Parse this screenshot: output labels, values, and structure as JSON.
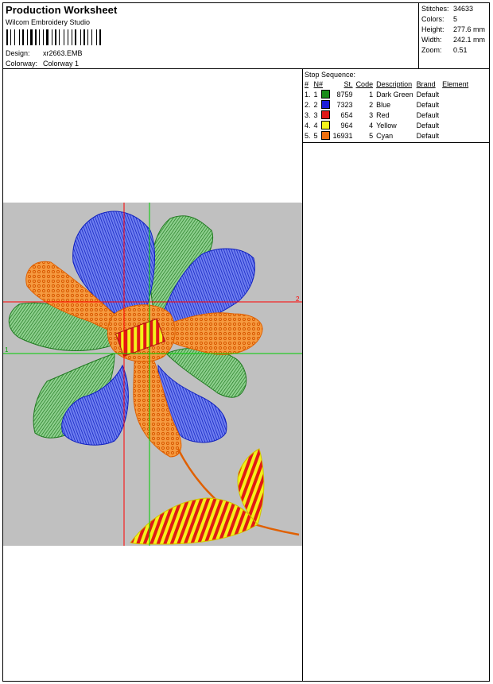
{
  "header": {
    "title": "Production Worksheet",
    "software": "Wilcom Embroidery Studio",
    "design_label": "Design:",
    "design_value": "xr2663.EMB",
    "colorway_label": "Colorway:",
    "colorway_value": "Colorway 1"
  },
  "stats": [
    {
      "label": "Stitches:",
      "value": "34633"
    },
    {
      "label": "Colors:",
      "value": "5"
    },
    {
      "label": "Height:",
      "value": "277.6 mm"
    },
    {
      "label": "Width:",
      "value": "242.1 mm"
    },
    {
      "label": "Zoom:",
      "value": "0.51"
    }
  ],
  "stop_sequence": {
    "title": "Stop Sequence:",
    "columns": [
      "#",
      "N#",
      "St.",
      "Code",
      "Description",
      "Brand",
      "Element"
    ],
    "rows": [
      {
        "num": "1.",
        "n": "1",
        "color": "#1a8c1a",
        "st": "8759",
        "code": "1",
        "desc": "Dark Green",
        "brand": "Default",
        "element": ""
      },
      {
        "num": "2.",
        "n": "2",
        "color": "#1c1cd9",
        "st": "7323",
        "code": "2",
        "desc": "Blue",
        "brand": "Default",
        "element": ""
      },
      {
        "num": "3.",
        "n": "3",
        "color": "#e01818",
        "st": "654",
        "code": "3",
        "desc": "Red",
        "brand": "Default",
        "element": ""
      },
      {
        "num": "4.",
        "n": "4",
        "color": "#f5f51a",
        "st": "964",
        "code": "4",
        "desc": "Yellow",
        "brand": "Default",
        "element": ""
      },
      {
        "num": "5.",
        "n": "5",
        "color": "#f07010",
        "st": "16931",
        "code": "5",
        "desc": "Cyan",
        "brand": "Default",
        "element": ""
      }
    ]
  },
  "design_view": {
    "axis_marker_red": "2",
    "axis_marker_green": "1",
    "colors": {
      "background": "#c0c0c0",
      "green": "#2f9a2f",
      "blue": "#1a2fd6",
      "red": "#e01818",
      "yellow": "#f2f21a",
      "orange": "#f07010",
      "axis_red": "#ff0000",
      "axis_green": "#00cc00"
    }
  }
}
